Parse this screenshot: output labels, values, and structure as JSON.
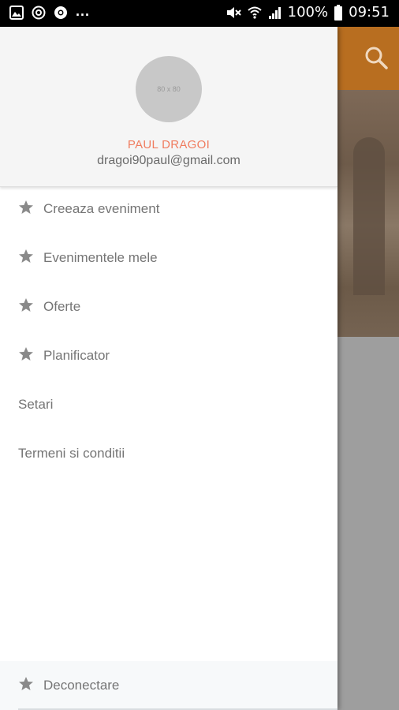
{
  "status_bar": {
    "battery": "100%",
    "time": "09:51",
    "more": "..."
  },
  "profile": {
    "avatar_placeholder": "80 x 80",
    "name": "PAUL DRAGOI",
    "email": "dragoi90paul@gmail.com"
  },
  "menu": {
    "items": [
      {
        "label": "Creeaza eveniment",
        "icon": "star-icon"
      },
      {
        "label": "Evenimentele mele",
        "icon": "star-icon"
      },
      {
        "label": "Oferte",
        "icon": "star-icon"
      },
      {
        "label": "Planificator",
        "icon": "star-icon"
      },
      {
        "label": "Setari"
      },
      {
        "label": "Termeni si conditii"
      }
    ],
    "logout_label": "Deconectare"
  },
  "colors": {
    "accent_name": "#f07c5f",
    "toolbar": "#b86e20",
    "icon": "#8a8a8a"
  }
}
